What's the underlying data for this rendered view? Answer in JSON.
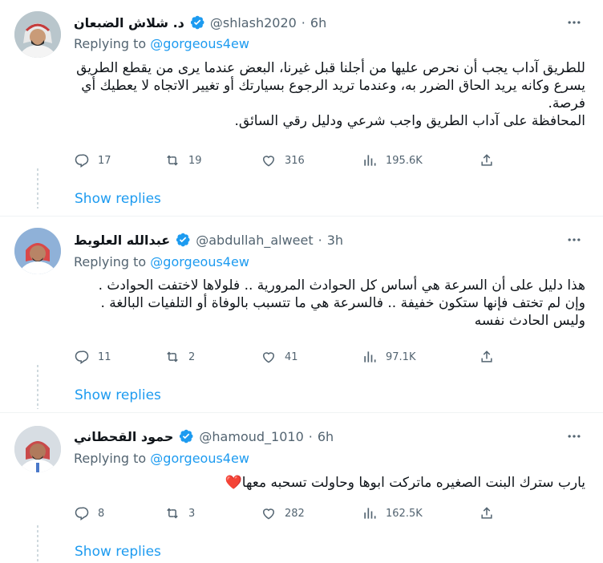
{
  "tweets": [
    {
      "name": "د. شلاش الضبعان",
      "handle": "@shlash2020",
      "time": "6h",
      "replying_prefix": "Replying to",
      "replying_to": "@gorgeous4ew",
      "text": "للطريق آداب يجب أن نحرص عليها من أجلنا قبل غيرنا، البعض عندما يرى من يقطع الطريق يسرع وكانه يريد الحاق الضرر به، وعندما تريد الرجوع بسيارتك أو تغيير الاتجاه لا يعطيك أي فرصة.\nالمحافظة على آداب الطريق واجب شرعي ودليل رقي السائق.",
      "stats": {
        "replies": "17",
        "retweets": "19",
        "likes": "316",
        "views": "195.6K"
      },
      "show_replies": "Show replies"
    },
    {
      "name": "عبدالله العلويط",
      "handle": "@abdullah_alweet",
      "time": "3h",
      "replying_prefix": "Replying to",
      "replying_to": "@gorgeous4ew",
      "text": "هذا دليل على أن السرعة هي أساس كل الحوادث المرورية .. فلولاها لاختفت الحوادث .\nوإن لم تختف فإنها ستكون خفيفة .. فالسرعة هي ما تتسبب بالوفاة أو التلفيات البالغة .\nوليس الحادث نفسه",
      "stats": {
        "replies": "11",
        "retweets": "2",
        "likes": "41",
        "views": "97.1K"
      },
      "show_replies": "Show replies"
    },
    {
      "name": "حمود القحطاني",
      "handle": "@hamoud_1010",
      "time": "6h",
      "replying_prefix": "Replying to",
      "replying_to": "@gorgeous4ew",
      "text": "يارب سترك البنت الصغيره ماتركت ابوها وحاولت تسحبه معها❤️",
      "stats": {
        "replies": "8",
        "retweets": "3",
        "likes": "282",
        "views": "162.5K"
      },
      "show_replies": "Show replies"
    }
  ],
  "icons": {
    "verified": "verified-badge-icon",
    "reply": "reply-icon",
    "retweet": "retweet-icon",
    "like": "heart-icon",
    "views": "views-icon",
    "share": "share-icon",
    "more": "more-icon"
  },
  "colors": {
    "accent": "#1d9bf0",
    "muted": "#536471",
    "text": "#0f1419"
  }
}
